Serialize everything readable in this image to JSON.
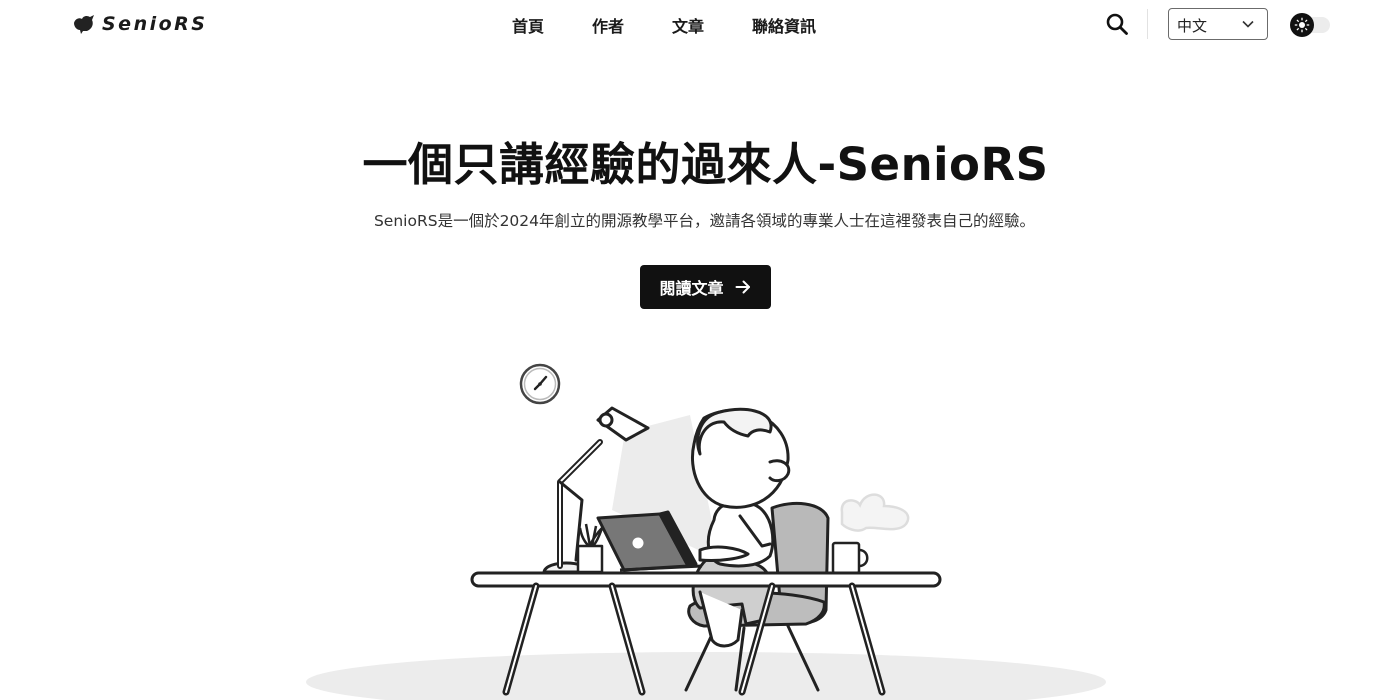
{
  "header": {
    "logo_text": "SenioRS",
    "nav": [
      {
        "label": "首頁"
      },
      {
        "label": "作者"
      },
      {
        "label": "文章"
      },
      {
        "label": "聯絡資訊"
      }
    ],
    "language_select": {
      "value": "中文"
    },
    "icons": {
      "logo": "bird-logo-icon",
      "search": "search-icon",
      "chevron": "chevron-down-icon",
      "theme": "sun-icon"
    }
  },
  "hero": {
    "title": "一個只講經驗的過來人-SenioRS",
    "subtitle": "SenioRS是一個於2024年創立的開源教學平台，邀請各領域的專業人士在這裡發表自己的經驗。",
    "cta_label": "閱讀文章",
    "cta_icon": "arrow-right-icon"
  },
  "colors": {
    "primary": "#111111",
    "background": "#ffffff",
    "muted_text": "#333333"
  }
}
